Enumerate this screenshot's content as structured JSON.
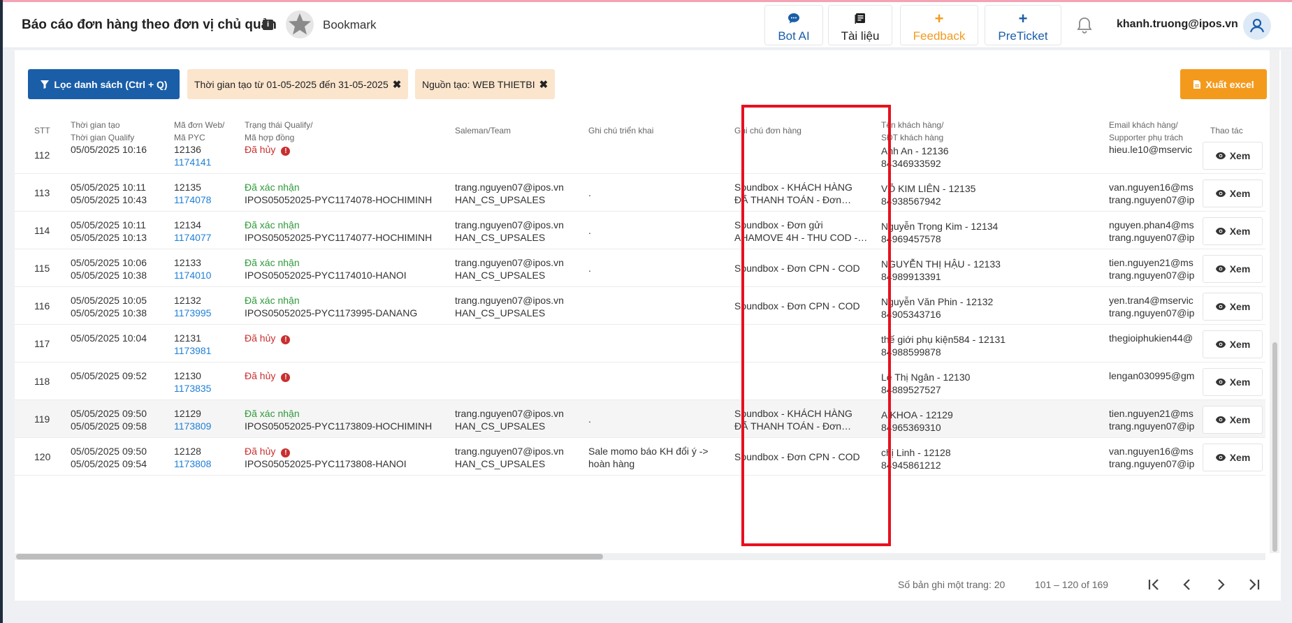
{
  "header": {
    "title": "Báo cáo đơn hàng theo đơn vị chủ quản",
    "bookmark_label": "Bookmark",
    "buttons": {
      "bot_ai": "Bot AI",
      "tai_lieu": "Tài liệu",
      "feedback": "Feedback",
      "preticket": "PreTicket"
    },
    "user_email": "khanh.truong@ipos.vn"
  },
  "toolbar": {
    "filter_button": "Lọc danh sách (Ctrl + Q)",
    "chips": [
      "Thời gian tạo từ 01-05-2025 đến 31-05-2025",
      "Nguồn tạo: WEB THIETBI"
    ],
    "export_button": "Xuất excel"
  },
  "table": {
    "columns": {
      "stt": "STT",
      "time_1": "Thời gian tạo",
      "time_2": "Thời gian Qualify",
      "code_1": "Mã đơn Web/",
      "code_2": "Mã PYC",
      "status_1": "Trạng thái Qualify/",
      "status_2": "Mã hợp đồng",
      "saleman": "Saleman/Team",
      "deploy_note": "Ghi chú triển khai",
      "order_note": "Ghi chú đơn hàng",
      "customer_1": "Tên khách hàng/",
      "customer_2": "SĐT khách hàng",
      "email_1": "Email khách hàng/",
      "email_2": "Supporter phụ trách",
      "action": "Thao tác"
    },
    "view_label": "Xem",
    "rows": [
      {
        "stt": "112",
        "created": "05/05/2025 10:16",
        "qualified": "",
        "web_code": "12136",
        "pyc": "1174141",
        "status": "Đã hủy",
        "status_type": "cancel",
        "contract": "",
        "saleman": "",
        "team": "",
        "deploy_note": "",
        "order_note_1": "",
        "order_note_2": "",
        "customer": "Anh An - 12136",
        "phone": "84346933592",
        "email": "hieu.le10@mservic",
        "supporter": ""
      },
      {
        "stt": "113",
        "created": "05/05/2025 10:11",
        "qualified": "05/05/2025 10:43",
        "web_code": "12135",
        "pyc": "1174078",
        "status": "Đã xác nhận",
        "status_type": "ok",
        "contract": "IPOS05052025-PYC1174078-HOCHIMINH",
        "saleman": "trang.nguyen07@ipos.vn",
        "team": "HAN_CS_UPSALES",
        "deploy_note": ".",
        "order_note_1": "Soundbox - KHÁCH HÀNG",
        "order_note_2": "ĐÃ THANH TOÁN - Đơn…",
        "customer": "VÕ KIM LIÊN - 12135",
        "phone": "84938567942",
        "email": "van.nguyen16@ms",
        "supporter": "trang.nguyen07@ip"
      },
      {
        "stt": "114",
        "created": "05/05/2025 10:11",
        "qualified": "05/05/2025 10:13",
        "web_code": "12134",
        "pyc": "1174077",
        "status": "Đã xác nhận",
        "status_type": "ok",
        "contract": "IPOS05052025-PYC1174077-HOCHIMINH",
        "saleman": "trang.nguyen07@ipos.vn",
        "team": "HAN_CS_UPSALES",
        "deploy_note": ".",
        "order_note_1": "Soundbox - Đơn gửi",
        "order_note_2": "AHAMOVE 4H - THU COD -…",
        "customer": "Nguyễn Trọng Kim - 12134",
        "phone": "84969457578",
        "email": "nguyen.phan4@ms",
        "supporter": "trang.nguyen07@ip"
      },
      {
        "stt": "115",
        "created": "05/05/2025 10:06",
        "qualified": "05/05/2025 10:38",
        "web_code": "12133",
        "pyc": "1174010",
        "status": "Đã xác nhận",
        "status_type": "ok",
        "contract": "IPOS05052025-PYC1174010-HANOI",
        "saleman": "trang.nguyen07@ipos.vn",
        "team": "HAN_CS_UPSALES",
        "deploy_note": ".",
        "order_note_1": "Soundbox - Đơn CPN - COD",
        "order_note_2": "",
        "customer": "NGUYỄN THỊ HẬU - 12133",
        "phone": "84989913391",
        "email": "tien.nguyen21@ms",
        "supporter": "trang.nguyen07@ip"
      },
      {
        "stt": "116",
        "created": "05/05/2025 10:05",
        "qualified": "05/05/2025 10:38",
        "web_code": "12132",
        "pyc": "1173995",
        "status": "Đã xác nhận",
        "status_type": "ok",
        "contract": "IPOS05052025-PYC1173995-DANANG",
        "saleman": "trang.nguyen07@ipos.vn",
        "team": "HAN_CS_UPSALES",
        "deploy_note": "",
        "order_note_1": "Soundbox - Đơn CPN - COD",
        "order_note_2": "",
        "customer": "Nguyễn Văn Phin - 12132",
        "phone": "84905343716",
        "email": "yen.tran4@mservic",
        "supporter": "trang.nguyen07@ip"
      },
      {
        "stt": "117",
        "created": "05/05/2025 10:04",
        "qualified": "",
        "web_code": "12131",
        "pyc": "1173981",
        "status": "Đã hủy",
        "status_type": "cancel",
        "contract": "",
        "saleman": "",
        "team": "",
        "deploy_note": "",
        "order_note_1": "",
        "order_note_2": "",
        "customer": "thế giới phụ kiện584 - 12131",
        "phone": "84988599878",
        "email": "thegioiphukien44@",
        "supporter": ""
      },
      {
        "stt": "118",
        "created": "05/05/2025 09:52",
        "qualified": "",
        "web_code": "12130",
        "pyc": "1173835",
        "status": "Đã hủy",
        "status_type": "cancel",
        "contract": "",
        "saleman": "",
        "team": "",
        "deploy_note": "",
        "order_note_1": "",
        "order_note_2": "",
        "customer": "Lê Thị Ngân - 12130",
        "phone": "84889527527",
        "email": "lengan030995@gm",
        "supporter": ""
      },
      {
        "stt": "119",
        "created": "05/05/2025 09:50",
        "qualified": "05/05/2025 09:58",
        "web_code": "12129",
        "pyc": "1173809",
        "status": "Đã xác nhận",
        "status_type": "ok",
        "contract": "IPOS05052025-PYC1173809-HOCHIMINH",
        "saleman": "trang.nguyen07@ipos.vn",
        "team": "HAN_CS_UPSALES",
        "deploy_note": ".",
        "order_note_1": "Soundbox - KHÁCH HÀNG",
        "order_note_2": "ĐÃ THANH TOÁN - Đơn…",
        "customer": "A KHOA - 12129",
        "phone": "84965369310",
        "email": "tien.nguyen21@ms",
        "supporter": "trang.nguyen07@ip"
      },
      {
        "stt": "120",
        "created": "05/05/2025 09:50",
        "qualified": "05/05/2025 09:54",
        "web_code": "12128",
        "pyc": "1173808",
        "status": "Đã hủy",
        "status_type": "cancel",
        "contract": "IPOS05052025-PYC1173808-HANOI",
        "saleman": "trang.nguyen07@ipos.vn",
        "team": "HAN_CS_UPSALES",
        "deploy_note": "Sale momo báo KH đổi ý ->\nhoàn hàng",
        "order_note_1": "Soundbox - Đơn CPN - COD",
        "order_note_2": "",
        "customer": "chị Linh - 12128",
        "phone": "84945861212",
        "email": "van.nguyen16@ms",
        "supporter": "trang.nguyen07@ip"
      }
    ]
  },
  "pagination": {
    "per_page_label": "Số bản ghi một trang: 20",
    "range_label": "101 – 120 of 169"
  },
  "colors": {
    "primary": "#1a5ea8",
    "accent_orange": "#f39a1d",
    "chip_bg": "#fbe5cd",
    "link": "#1e7fd8",
    "cancel": "#c92f2f",
    "confirmed": "#2f9a3a",
    "highlight_border": "#e8101f"
  }
}
